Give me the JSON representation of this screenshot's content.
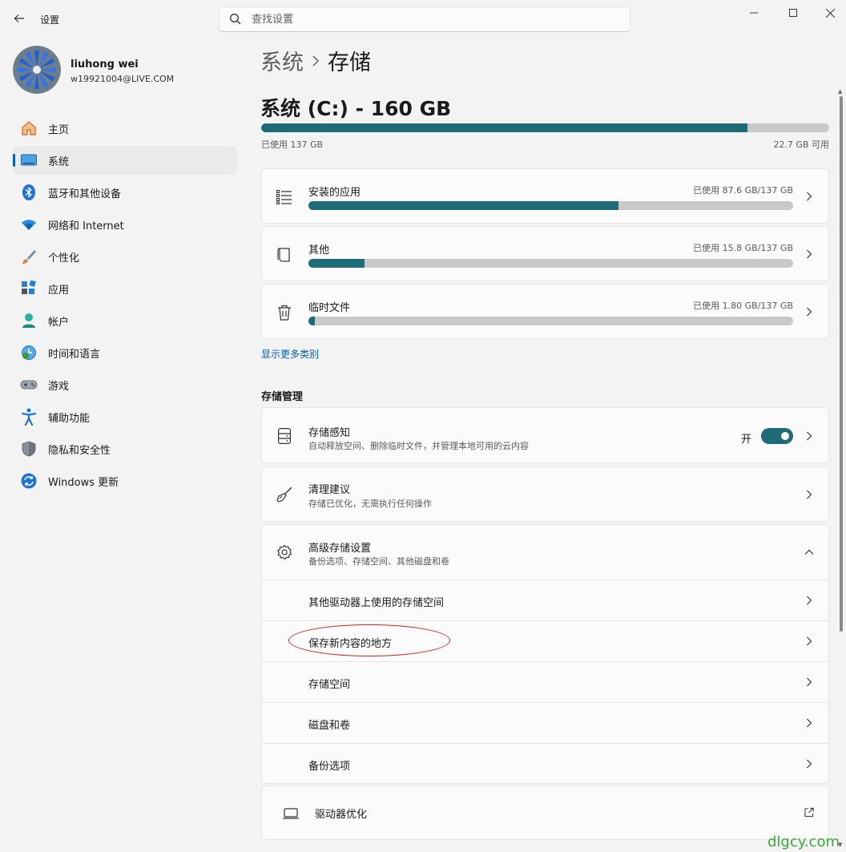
{
  "window": {
    "app_title": "设置",
    "search_placeholder": "查找设置"
  },
  "profile": {
    "name": "liuhong wei",
    "email": "w19921004@LIVE.COM"
  },
  "sidebar": {
    "items": [
      {
        "label": "主页",
        "icon": "home-icon"
      },
      {
        "label": "系统",
        "icon": "system-icon",
        "active": true
      },
      {
        "label": "蓝牙和其他设备",
        "icon": "bluetooth-icon"
      },
      {
        "label": "网络和 Internet",
        "icon": "wifi-icon"
      },
      {
        "label": "个性化",
        "icon": "brush-icon"
      },
      {
        "label": "应用",
        "icon": "apps-icon"
      },
      {
        "label": "帐户",
        "icon": "account-icon"
      },
      {
        "label": "时间和语言",
        "icon": "clock-globe-icon"
      },
      {
        "label": "游戏",
        "icon": "gamepad-icon"
      },
      {
        "label": "辅助功能",
        "icon": "accessibility-icon"
      },
      {
        "label": "隐私和安全性",
        "icon": "shield-icon"
      },
      {
        "label": "Windows 更新",
        "icon": "update-icon"
      }
    ]
  },
  "breadcrumb": {
    "parent": "系统",
    "current": "存储"
  },
  "drive": {
    "title": "系统 (C:) - 160 GB",
    "used_label": "已使用 137 GB",
    "free_label": "22.7 GB 可用",
    "used_fraction": 0.856
  },
  "categories": [
    {
      "name": "安装的应用",
      "used": "已使用 87.6 GB/137 GB",
      "fraction": 0.639,
      "icon": "list-icon"
    },
    {
      "name": "其他",
      "used": "已使用 15.8 GB/137 GB",
      "fraction": 0.115,
      "icon": "document-icon"
    },
    {
      "name": "临时文件",
      "used": "已使用 1.80 GB/137 GB",
      "fraction": 0.013,
      "icon": "trash-icon"
    }
  ],
  "show_more_link": "显示更多类别",
  "storage_management": {
    "section_title": "存储管理",
    "storage_sense": {
      "title": "存储感知",
      "subtitle": "自动释放空间、删除临时文件，并管理本地可用的云内容",
      "toggle_label": "开",
      "enabled": true
    },
    "cleanup": {
      "title": "清理建议",
      "subtitle": "存储已优化，无需执行任何操作"
    },
    "advanced": {
      "title": "高级存储设置",
      "subtitle": "备份选项、存储空间、其他磁盘和卷",
      "expanded": true,
      "items": [
        "其他驱动器上使用的存储空间",
        "保存新内容的地方",
        "存储空间",
        "磁盘和卷",
        "备份选项"
      ]
    },
    "optimize": {
      "title": "驱动器优化"
    }
  },
  "watermark": "dlgcy.com",
  "colors": {
    "accent": "#1f6b78",
    "link": "#005fb8",
    "highlight": "#d32020"
  }
}
